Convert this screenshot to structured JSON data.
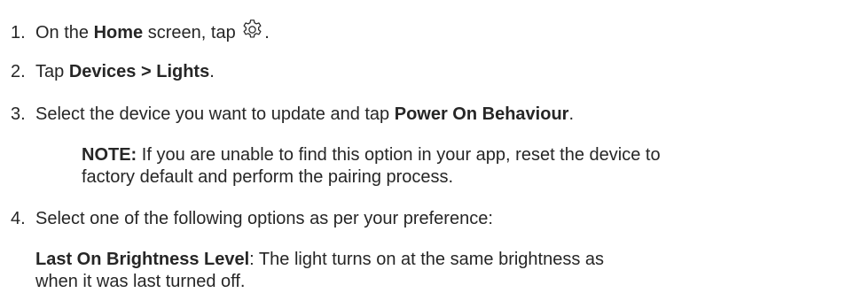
{
  "steps": [
    {
      "num": "1.",
      "pre": "On the ",
      "bold": "Home",
      "mid": " screen, tap ",
      "icon": "gear-icon",
      "post": "."
    },
    {
      "num": "2.",
      "pre": "Tap ",
      "bold": "Devices > Lights",
      "post": "."
    },
    {
      "num": "3.",
      "pre": "Select the device you want to update and tap ",
      "bold": "Power On Behaviour",
      "post": "."
    },
    {
      "num": "4.",
      "text": "Select one of the following options as per your preference:"
    }
  ],
  "note": {
    "label": "NOTE:",
    "line1": " If you are unable to find this option in your app, reset the device to",
    "line2": "factory default and perform the pairing process."
  },
  "option": {
    "label": "Last On Brightness Level",
    "line1": ": The light turns on at the same brightness as",
    "line2": "when it was last turned off."
  }
}
